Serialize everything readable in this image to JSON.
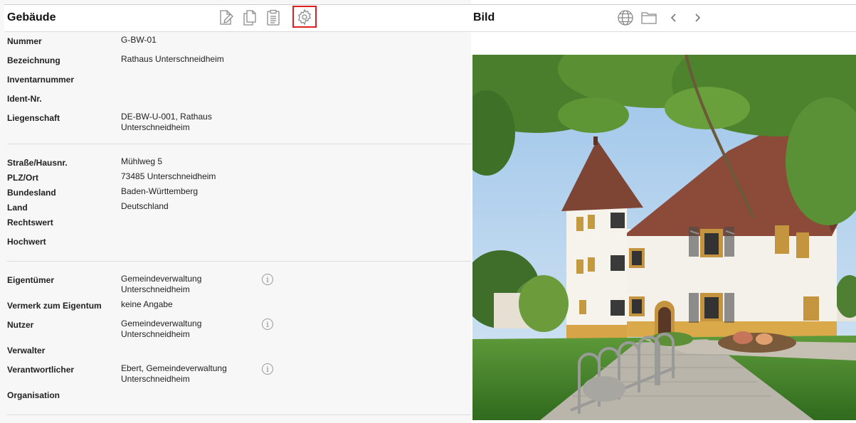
{
  "left": {
    "title": "Gebäude",
    "toolbar": {
      "edit_icon": "edit-document-icon",
      "copy_icon": "copy-icon",
      "clipboard_icon": "clipboard-icon",
      "settings_icon": "gear-icon"
    },
    "fields": [
      {
        "label": "Nummer",
        "value": "G-BW-01"
      },
      {
        "label": "Bezeichnung",
        "value": "Rathaus Unterschneidheim"
      },
      {
        "label": "Inventarnummer",
        "value": ""
      },
      {
        "label": "Ident-Nr.",
        "value": ""
      },
      {
        "label": "Liegenschaft",
        "value_line1": "DE-BW-U-001, Rathaus",
        "value_line2": "Unterschneidheim"
      },
      {
        "label": "Straße/Hausnr.",
        "value": "Mühlweg 5"
      },
      {
        "label": "PLZ/Ort",
        "value": "73485 Unterschneidheim"
      },
      {
        "label": "Bundesland",
        "value": "Baden-Württemberg"
      },
      {
        "label": "Land",
        "value": "Deutschland"
      },
      {
        "label": "Rechtswert",
        "value": ""
      },
      {
        "label": "Hochwert",
        "value": ""
      },
      {
        "label": "Eigentümer",
        "value_line1": "Gemeindeverwaltung",
        "value_line2": "Unterschneidheim"
      },
      {
        "label": "Vermerk zum Eigentum",
        "value": "keine Angabe"
      },
      {
        "label": "Nutzer",
        "value_line1": "Gemeindeverwaltung",
        "value_line2": "Unterschneidheim"
      },
      {
        "label": "Verwalter",
        "value": ""
      },
      {
        "label": "Verantwortlicher",
        "value_line1": "Ebert, Gemeindeverwaltung",
        "value_line2": "Unterschneidheim"
      },
      {
        "label": "Organisation",
        "value": ""
      }
    ],
    "info_glyph": "i"
  },
  "right": {
    "title": "Bild",
    "toolbar": {
      "globe_icon": "globe-icon",
      "folder_icon": "folder-icon",
      "prev_icon": "chevron-left-icon",
      "next_icon": "chevron-right-icon"
    },
    "photo_icon": "building-photo"
  },
  "colors": {
    "highlight": "#e02020",
    "panel_bg": "#f7f7f7",
    "separator": "#dcdcdc"
  }
}
